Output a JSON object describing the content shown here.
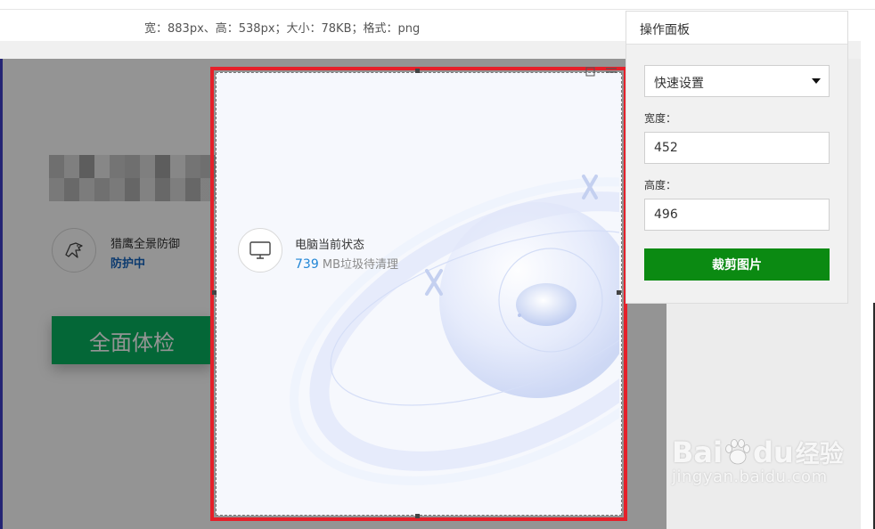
{
  "info_bar": {
    "text": "宽：883px、高：538px；大小：78KB；格式：png"
  },
  "screenshot": {
    "eagle_title": "猎鹰全景防御",
    "eagle_status": "防护中",
    "check_button": "全面体检",
    "pc_title": "电脑当前状态",
    "pc_junk_value": "739",
    "pc_junk_text": " MB垃圾待清理"
  },
  "panel": {
    "title": "操作面板",
    "preset_select": "快速设置",
    "width_label": "宽度：",
    "width_value": "452",
    "height_label": "高度：",
    "height_value": "496",
    "crop_button": "裁剪图片"
  },
  "watermark": {
    "brand_bai": "Bai",
    "brand_du": "du",
    "brand_cn": "经验",
    "url": "jingyan.baidu.com"
  },
  "colors": {
    "crop_border": "#e5202a",
    "check_button": "#07b25f",
    "crop_action": "#0b8a12",
    "accent_blue": "#2186d6"
  },
  "icons": [
    "eagle-icon",
    "monitor-icon",
    "dropdown-arrow-icon",
    "paw-icon",
    "crop-handle-icon"
  ]
}
